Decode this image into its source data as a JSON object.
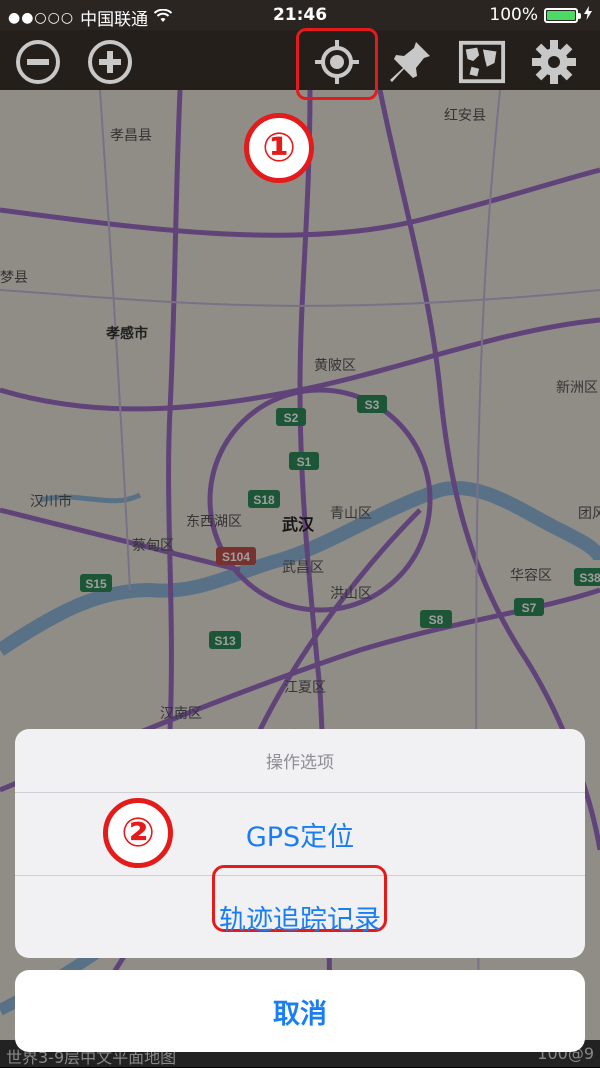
{
  "status_bar": {
    "signal": "●●○○○",
    "carrier": "中国联通",
    "time": "21:46",
    "battery_pct": "100%"
  },
  "toolbar": {
    "buttons": [
      "zoom-out",
      "zoom-in",
      "locate",
      "pin",
      "map",
      "settings"
    ]
  },
  "annotations": {
    "badge1": "①",
    "badge2": "②"
  },
  "map": {
    "labels": [
      {
        "text": "孝昌县"
      },
      {
        "text": "红安县"
      },
      {
        "text": "梦县"
      },
      {
        "text": "孝感市"
      },
      {
        "text": "黄陂区"
      },
      {
        "text": "新洲区"
      },
      {
        "text": "汉川市"
      },
      {
        "text": "东西湖区"
      },
      {
        "text": "武汉"
      },
      {
        "text": "青山区"
      },
      {
        "text": "蔡甸区"
      },
      {
        "text": "武昌区"
      },
      {
        "text": "洪山区"
      },
      {
        "text": "华容区"
      },
      {
        "text": "江夏区"
      },
      {
        "text": "汉南区"
      },
      {
        "text": "团风"
      }
    ],
    "shields": [
      "S2",
      "S3",
      "S1",
      "S18",
      "S104",
      "S15",
      "S13",
      "S8",
      "S7",
      "S38"
    ]
  },
  "action_sheet": {
    "title": "操作选项",
    "option_gps": "GPS定位",
    "option_track": "轨迹追踪记录",
    "cancel": "取消"
  },
  "bottom_bar": {
    "left_text": "世界3-9层中文平面地图",
    "right_text": "100@9"
  },
  "colors": {
    "accent_blue": "#1a7ef2",
    "annotation_red": "#e31b1b",
    "road_purple": "#9b6dc4",
    "river_blue": "#8fb6d8",
    "shield_green": "#2e8b57"
  }
}
